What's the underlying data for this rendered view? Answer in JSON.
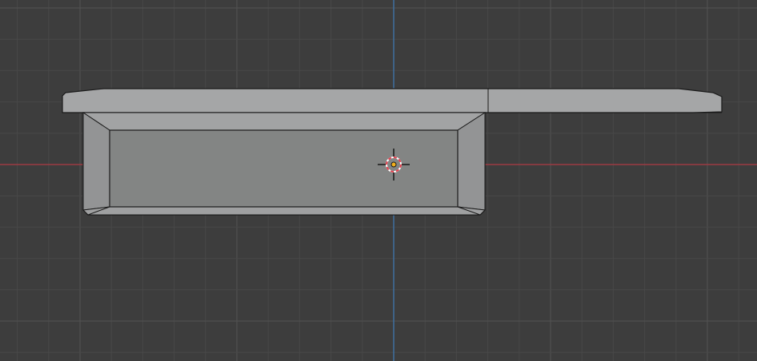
{
  "app": "3D Viewport",
  "view": {
    "projection": "orthographic",
    "grid": true,
    "axes_visible": [
      "x",
      "z"
    ]
  },
  "colors": {
    "background": "#3d3d3d",
    "grid_minor": "#484848",
    "grid_major": "#525252",
    "x_axis": "#9b3b43",
    "z_axis": "#3e6f9f",
    "mesh_light": "#a5a6a7",
    "mesh_mid": "#9a9b9c",
    "mesh_inner": "#838584",
    "mesh_edge": "#1a1a1a",
    "cursor_red": "#e6414f",
    "cursor_white": "#ffffff",
    "origin": "#f2b01c"
  },
  "icons": {
    "cursor": "3d-cursor-icon",
    "origin": "object-origin-icon"
  }
}
